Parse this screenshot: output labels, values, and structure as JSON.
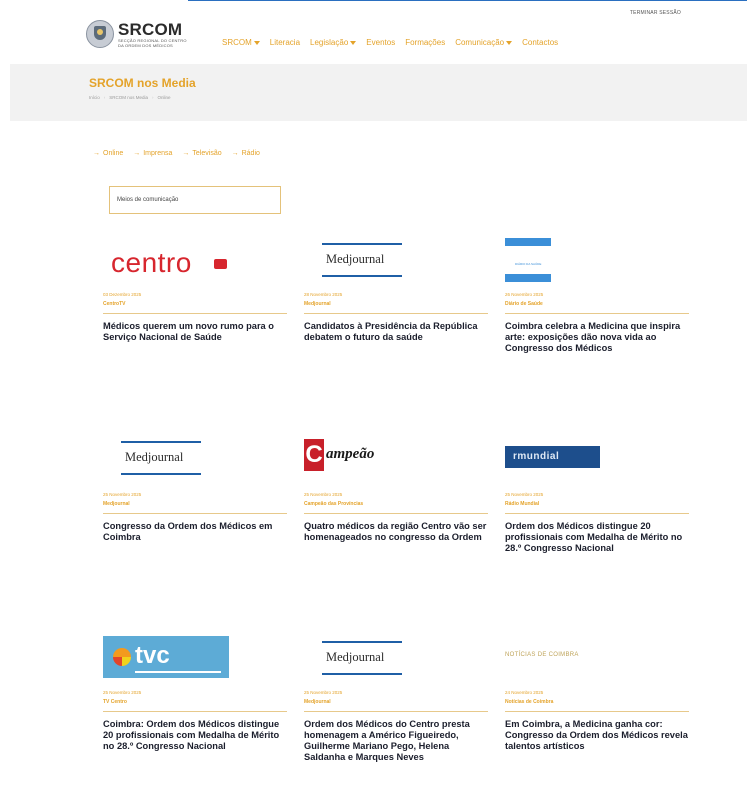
{
  "topbar": {
    "logout": "TERMINAR SESSÃO"
  },
  "brand": {
    "title": "SRCOM",
    "subtitle_1": "SECÇÃO REGIONAL DO CENTRO",
    "subtitle_2": "DA ORDEM DOS MÉDICOS"
  },
  "nav": {
    "items": [
      {
        "label": "SRCOM",
        "dropdown": true
      },
      {
        "label": "Literacia",
        "dropdown": false
      },
      {
        "label": "Legislação",
        "dropdown": true
      },
      {
        "label": "Eventos",
        "dropdown": false
      },
      {
        "label": "Formações",
        "dropdown": false
      },
      {
        "label": "Comunicação",
        "dropdown": true
      },
      {
        "label": "Contactos",
        "dropdown": false
      }
    ]
  },
  "hero": {
    "title": "SRCOM nos Media",
    "breadcrumb": [
      "Início",
      "SRCOM nos Media",
      "Online"
    ]
  },
  "filters": [
    {
      "label": "Online"
    },
    {
      "label": "Imprensa"
    },
    {
      "label": "Televisão"
    },
    {
      "label": "Rádio"
    }
  ],
  "search": {
    "label": "Meios de comunicação"
  },
  "cards": [
    {
      "logo_text": "centro",
      "date": "03 Dezembro 2025",
      "source": "CentroTV",
      "title": "Médicos querem um novo rumo para o Serviço Nacional de Saúde"
    },
    {
      "logo_text": "Medjournal",
      "date": "28 Novembro 2025",
      "source": "Medjournal",
      "title": "Candidatos à Presidência da República debatem o futuro da saúde"
    },
    {
      "logo_text": "DIÁRIO DA SAÚDE",
      "date": "26 Novembro 2025",
      "source": "Diário de Saúde",
      "title": "Coimbra celebra a Medicina que inspira arte: exposições dão nova vida ao Congresso dos Médicos"
    },
    {
      "logo_text": "Medjournal",
      "date": "25 Novembro 2025",
      "source": "Medjournal",
      "title": "Congresso da Ordem dos Médicos em Coimbra"
    },
    {
      "logo_text": "ampeão",
      "logo_initial": "C",
      "date": "25 Novembro 2025",
      "source": "Campeão das Províncias",
      "title": "Quatro médicos da região Centro vão ser homenageados no congresso da Ordem"
    },
    {
      "logo_text": "rmundial",
      "date": "25 Novembro 2025",
      "source": "Rádio Mundial",
      "title": "Ordem dos Médicos distingue 20 profissionais com Medalha de Mérito no 28.º Congresso Nacional"
    },
    {
      "logo_text": "tvc",
      "date": "25 Novembro 2025",
      "source": "TV Centro",
      "title": "Coimbra: Ordem dos Médicos distingue 20 profissionais com Medalha de Mérito no 28.º Congresso Nacional"
    },
    {
      "logo_text": "Medjournal",
      "date": "25 Novembro 2025",
      "source": "Medjournal",
      "title": "Ordem dos Médicos do Centro presta homenagem a Américo Figueiredo, Guilherme Mariano Pego, Helena Saldanha e Marques Neves"
    },
    {
      "logo_text": "NOTÍCIAS DE COIMBRA",
      "date": "24 Novembro 2025",
      "source": "Notícias de Coimbra",
      "title": "Em Coimbra, a Medicina ganha cor: Congresso da Ordem dos Médicos revela talentos artísticos"
    }
  ],
  "colors": {
    "accent": "#e4a32a",
    "hero_bg": "#f2f2f2",
    "title": "#1b1e2c"
  }
}
